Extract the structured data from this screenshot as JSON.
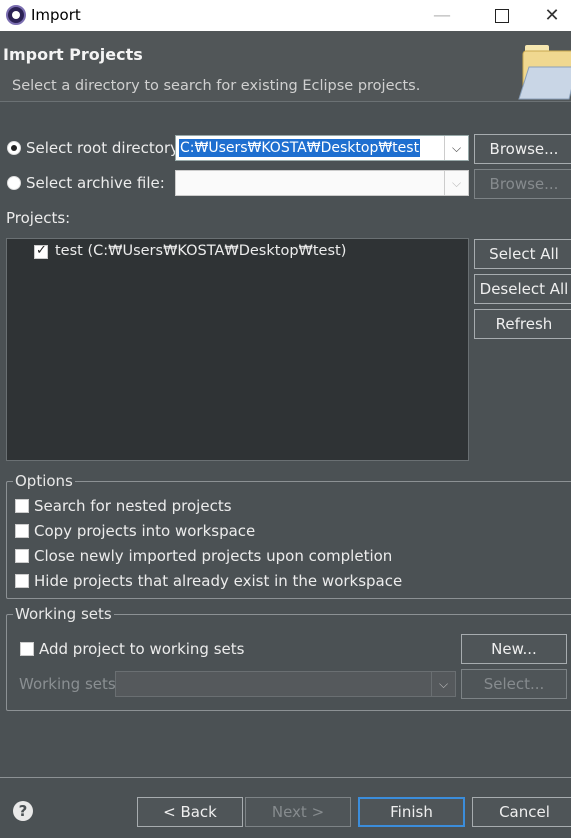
{
  "window": {
    "title": "Import"
  },
  "header": {
    "title": "Import Projects",
    "description": "Select a directory to search for existing Eclipse projects."
  },
  "source": {
    "root_dir_label": "Select root directory:",
    "root_dir_value": "C:₩Users₩KOSTA₩Desktop₩test",
    "archive_label": "Select archive file:",
    "archive_value": "",
    "browse_label": "Browse...",
    "browse_archive_label": "Browse..."
  },
  "projects": {
    "label": "Projects:",
    "items": [
      {
        "label": "test (C:₩Users₩KOSTA₩Desktop₩test)",
        "checked": true
      }
    ],
    "select_all": "Select All",
    "deselect_all": "Deselect All",
    "refresh": "Refresh"
  },
  "options": {
    "title": "Options",
    "items": [
      {
        "label": "Search for nested projects",
        "checked": false
      },
      {
        "label": "Copy projects into workspace",
        "checked": false
      },
      {
        "label": "Close newly imported projects upon completion",
        "checked": false
      },
      {
        "label": "Hide projects that already exist in the workspace",
        "checked": false
      }
    ]
  },
  "working_sets": {
    "title": "Working sets",
    "add_label": "Add project to working sets",
    "new_label": "New...",
    "sets_label": "Working sets:",
    "sets_value": "",
    "select_label": "Select..."
  },
  "footer": {
    "back": "< Back",
    "next": "Next >",
    "finish": "Finish",
    "cancel": "Cancel"
  }
}
